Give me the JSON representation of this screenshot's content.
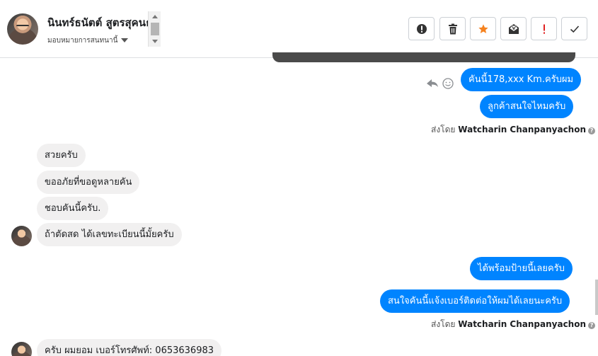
{
  "header": {
    "contact_name": "นินทร์ธนัตต์ สูตรสุคนธ์",
    "assign_label": "มอบหมายการสนทนานี้"
  },
  "toolbar": [
    {
      "name": "spam-button",
      "icon": "exclamation-circle-icon"
    },
    {
      "name": "delete-button",
      "icon": "trash-icon"
    },
    {
      "name": "star-button",
      "icon": "star-icon",
      "color": "#f5821f"
    },
    {
      "name": "mark-unread-button",
      "icon": "envelope-open-icon"
    },
    {
      "name": "follow-up-button",
      "icon": "exclamation-icon",
      "color": "#e02020"
    },
    {
      "name": "mark-done-button",
      "icon": "checkmark-icon"
    }
  ],
  "colors": {
    "outgoing_bubble": "#0084ff",
    "incoming_bubble": "#f1f0f0",
    "star": "#f5821f",
    "alert": "#e02020"
  },
  "messages": {
    "m1": "คันนี้178,xxx Km.ครับผม",
    "m2": "ลูกค้าสนใจไหมครับ",
    "sent_by_1": {
      "prefix": "ส่งโดย",
      "name": "Watcharin Chanpanyachon"
    },
    "m3": "สวยครับ",
    "m4": "ขออภัยที่ขอดูหลายคัน",
    "m5": "ชอบคันนี้ครับ.",
    "m6": "ถ้าตัดสด ได้เลขทะเบียนนี้มั้ยครับ",
    "m7": "ได้พร้อมป้ายนี้เลยครับ",
    "m8": "สนใจคันนี้แจ้งเบอร์ติดต่อให้ผมได้เลยนะครับ",
    "sent_by_2": {
      "prefix": "ส่งโดย",
      "name": "Watcharin Chanpanyachon"
    },
    "m9": "ครับ ผมยอม เบอร์โทรศัพท์: 0653636983"
  }
}
